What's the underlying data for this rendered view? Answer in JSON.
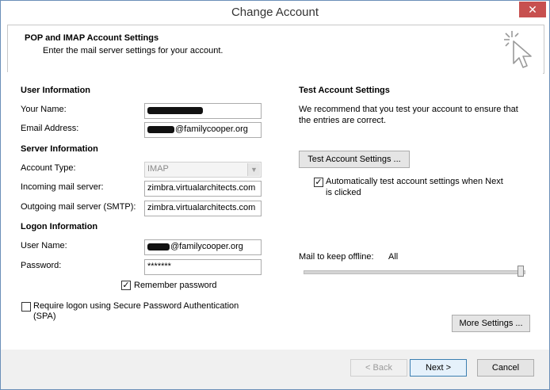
{
  "window": {
    "title": "Change Account",
    "close_label": "✕"
  },
  "header": {
    "title": "POP and IMAP Account Settings",
    "subtitle": "Enter the mail server settings for your account."
  },
  "user_info": {
    "heading": "User Information",
    "name_label": "Your Name:",
    "name_value": "",
    "email_label": "Email Address:",
    "email_value": "@familycooper.org"
  },
  "server_info": {
    "heading": "Server Information",
    "account_type_label": "Account Type:",
    "account_type_value": "IMAP",
    "incoming_label": "Incoming mail server:",
    "incoming_value": "zimbra.virtualarchitects.com",
    "outgoing_label": "Outgoing mail server (SMTP):",
    "outgoing_value": "zimbra.virtualarchitects.com"
  },
  "logon_info": {
    "heading": "Logon Information",
    "username_label": "User Name:",
    "username_value": "@familycooper.org",
    "password_label": "Password:",
    "password_value": "*******",
    "remember_label": "Remember password",
    "remember_checked": true,
    "spa_label_line1": "Require logon using Secure Password Authentication",
    "spa_label_line2": "(SPA)",
    "spa_checked": false
  },
  "test_settings": {
    "heading": "Test Account Settings",
    "desc_line1": "We recommend that you test your account to ensure that",
    "desc_line2": "the entries are correct.",
    "button_label": "Test Account Settings ...",
    "auto_label_line1": "Automatically test account settings when Next",
    "auto_label_line2": "is clicked",
    "auto_checked": true
  },
  "offline": {
    "label": "Mail to keep offline:",
    "value": "All",
    "level_fraction": 1.0
  },
  "more_settings_label": "More Settings ...",
  "footer": {
    "back_label": "< Back",
    "next_label": "Next >",
    "cancel_label": "Cancel"
  },
  "colors": {
    "close_bg": "#c7504f",
    "primary_border": "#3c7fb1",
    "window_border": "#6b8fb8"
  },
  "icons": {
    "header_art": "cursor-sparkle-icon",
    "checkmark": "checkmark-icon",
    "dropdown": "chevron-down-icon"
  }
}
